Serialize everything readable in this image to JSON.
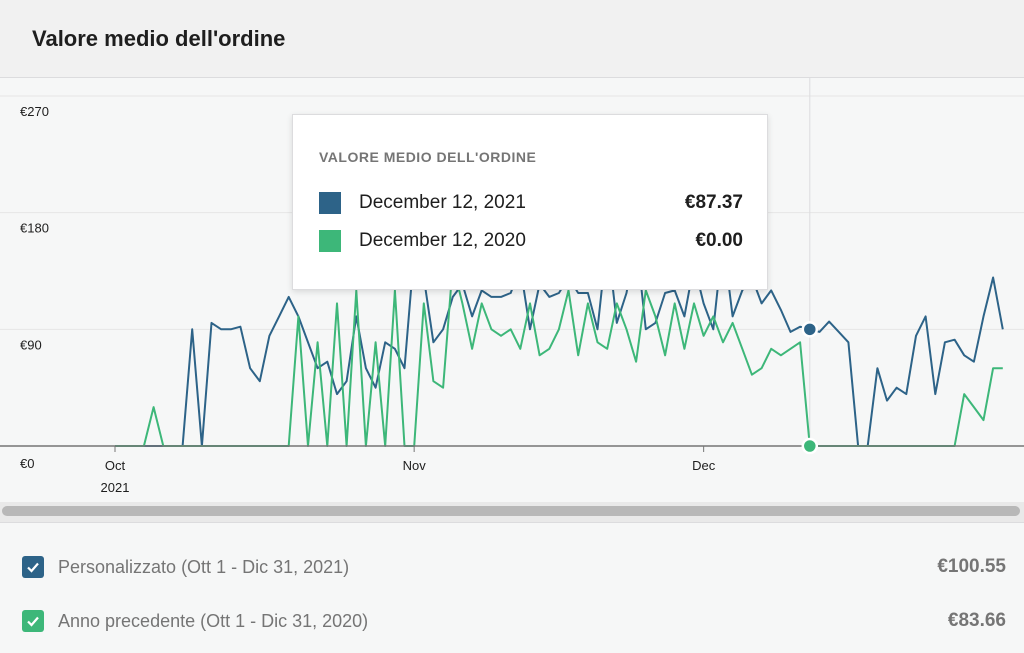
{
  "header": {
    "title": "Valore medio dell'ordine"
  },
  "colors": {
    "current": "#2d6388",
    "previous": "#3db779"
  },
  "chart_data": {
    "type": "line",
    "title": "Valore medio dell'ordine",
    "xlabel": "",
    "ylabel": "",
    "ylim": [
      0,
      270
    ],
    "y_ticks": [
      "€0",
      "€90",
      "€180",
      "€270"
    ],
    "y_tick_values": [
      0,
      90,
      180,
      270
    ],
    "x_ticks": [
      {
        "label": "Oct",
        "sublabel": "2021",
        "day": 1
      },
      {
        "label": "Nov",
        "sublabel": "",
        "day": 32
      },
      {
        "label": "Dec",
        "sublabel": "",
        "day": 62
      }
    ],
    "xlim": [
      1,
      92
    ],
    "grid": true,
    "hover_day": 73,
    "series": [
      {
        "name": "Personalizzato (Ott 1 - Dic 31, 2021)",
        "color": "#2d6388",
        "values": [
          0,
          0,
          0,
          0,
          0,
          0,
          0,
          0,
          90,
          0,
          95,
          90,
          90,
          92,
          60,
          50,
          85,
          100,
          115,
          100,
          80,
          60,
          65,
          40,
          50,
          100,
          60,
          45,
          80,
          75,
          60,
          150,
          130,
          80,
          90,
          115,
          125,
          100,
          120,
          115,
          115,
          118,
          138,
          90,
          125,
          115,
          118,
          130,
          118,
          118,
          90,
          160,
          95,
          118,
          160,
          90,
          95,
          118,
          120,
          100,
          140,
          110,
          90,
          160,
          100,
          120,
          130,
          110,
          120,
          105,
          88,
          92,
          90,
          88,
          96,
          88,
          80,
          0,
          0,
          60,
          35,
          45,
          40,
          85,
          100,
          40,
          80,
          82,
          70,
          65,
          100,
          130,
          90
        ]
      },
      {
        "name": "Anno precedente (Ott 1 - Dic 31, 2020)",
        "color": "#3db779",
        "values": [
          0,
          0,
          0,
          0,
          30,
          0,
          0,
          0,
          0,
          0,
          0,
          0,
          0,
          0,
          0,
          0,
          0,
          0,
          0,
          100,
          0,
          80,
          0,
          110,
          0,
          120,
          0,
          80,
          0,
          120,
          0,
          0,
          110,
          50,
          45,
          140,
          110,
          75,
          110,
          90,
          85,
          90,
          75,
          110,
          70,
          75,
          90,
          120,
          70,
          110,
          80,
          75,
          110,
          90,
          65,
          120,
          100,
          70,
          110,
          75,
          110,
          85,
          100,
          80,
          95,
          75,
          55,
          60,
          75,
          70,
          75,
          80,
          0,
          0,
          0,
          0,
          0,
          0,
          0,
          0,
          0,
          0,
          0,
          0,
          0,
          0,
          0,
          0,
          40,
          30,
          20,
          60,
          60
        ]
      }
    ],
    "tooltip": {
      "title": "VALORE MEDIO DELL'ORDINE",
      "rows": [
        {
          "date": "December 12, 2021",
          "value": "€87.37",
          "color": "#2d6388"
        },
        {
          "date": "December 12, 2020",
          "value": "€0.00",
          "color": "#3db779"
        }
      ]
    }
  },
  "legend": {
    "items": [
      {
        "label": "Personalizzato (Ott 1 - Dic 31, 2021)",
        "total": "€100.55",
        "color": "#2d6388"
      },
      {
        "label": "Anno precedente (Ott 1 - Dic 31, 2020)",
        "total": "€83.66",
        "color": "#3db779"
      }
    ]
  }
}
